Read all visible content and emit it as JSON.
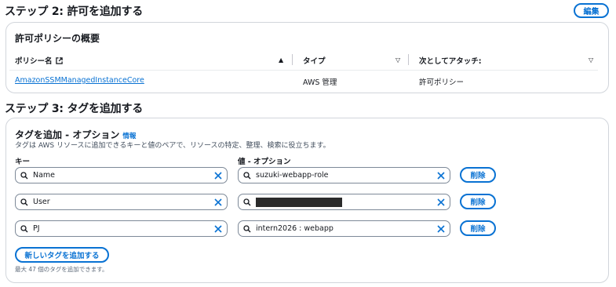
{
  "step2": {
    "title": "ステップ 2: 許可を追加する",
    "edit_label": "編集",
    "panel_title": "許可ポリシーの概要",
    "columns": [
      "ポリシー名",
      "タイプ",
      "次としてアタッチ:"
    ],
    "rows": [
      {
        "policy_name": "AmazonSSMManagedInstanceCore",
        "type": "AWS 管理",
        "attached_as": "許可ポリシー"
      }
    ]
  },
  "step3": {
    "title": "ステップ 3: タグを追加する",
    "panel_title": "タグを追加 - オプション",
    "info_label": "情報",
    "description": "タグは AWS リソースに追加できるキーと値のペアで、リソースの特定、整理、検索に役立ちます。",
    "key_label": "キー",
    "value_label": "値 - オプション",
    "tags": [
      {
        "key": "Name",
        "value": "suzuki-webapp-role",
        "remove_label": "削除"
      },
      {
        "key": "User",
        "value": "",
        "value_redacted": true,
        "remove_label": "削除"
      },
      {
        "key": "PJ",
        "value": "intern2026 : webapp",
        "remove_label": "削除"
      }
    ],
    "add_tag_label": "新しいタグを追加する",
    "limit_hint": "最大 47 個のタグを追加できます。"
  },
  "icons": {
    "external_link": "external-link-icon",
    "search": "search-icon",
    "clear": "close-icon",
    "sort_asc": "caret-up-icon",
    "sort_desc": "caret-down-outline-icon"
  },
  "colors": {
    "accent": "#0972d3",
    "border": "#7d8998",
    "text": "#16191f"
  }
}
